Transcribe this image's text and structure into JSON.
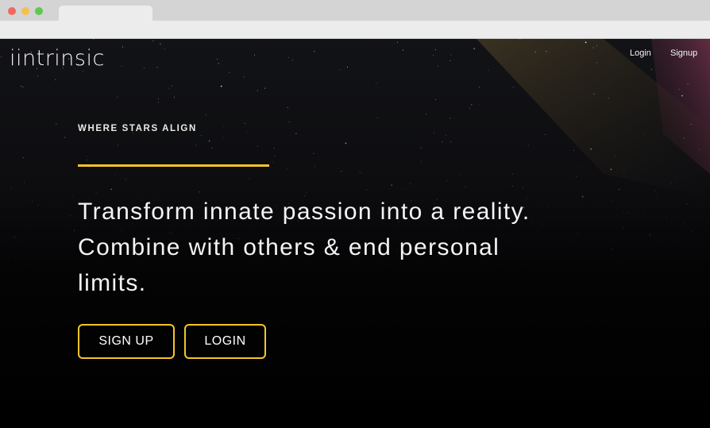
{
  "browser": {
    "controls": [
      "close",
      "minimize",
      "maximize"
    ]
  },
  "header": {
    "brand": "iintrinsic",
    "nav": {
      "login_label": "Login",
      "signup_label": "Signup"
    }
  },
  "hero": {
    "eyebrow": "WHERE STARS ALIGN",
    "headline": "Transform innate passion into a reality. Combine with others & end personal limits.",
    "signup_button": "SIGN UP",
    "login_button": "LOGIN"
  },
  "colors": {
    "accent": "#f5c52a",
    "background": "#000000",
    "text": "#f4f4f4"
  }
}
